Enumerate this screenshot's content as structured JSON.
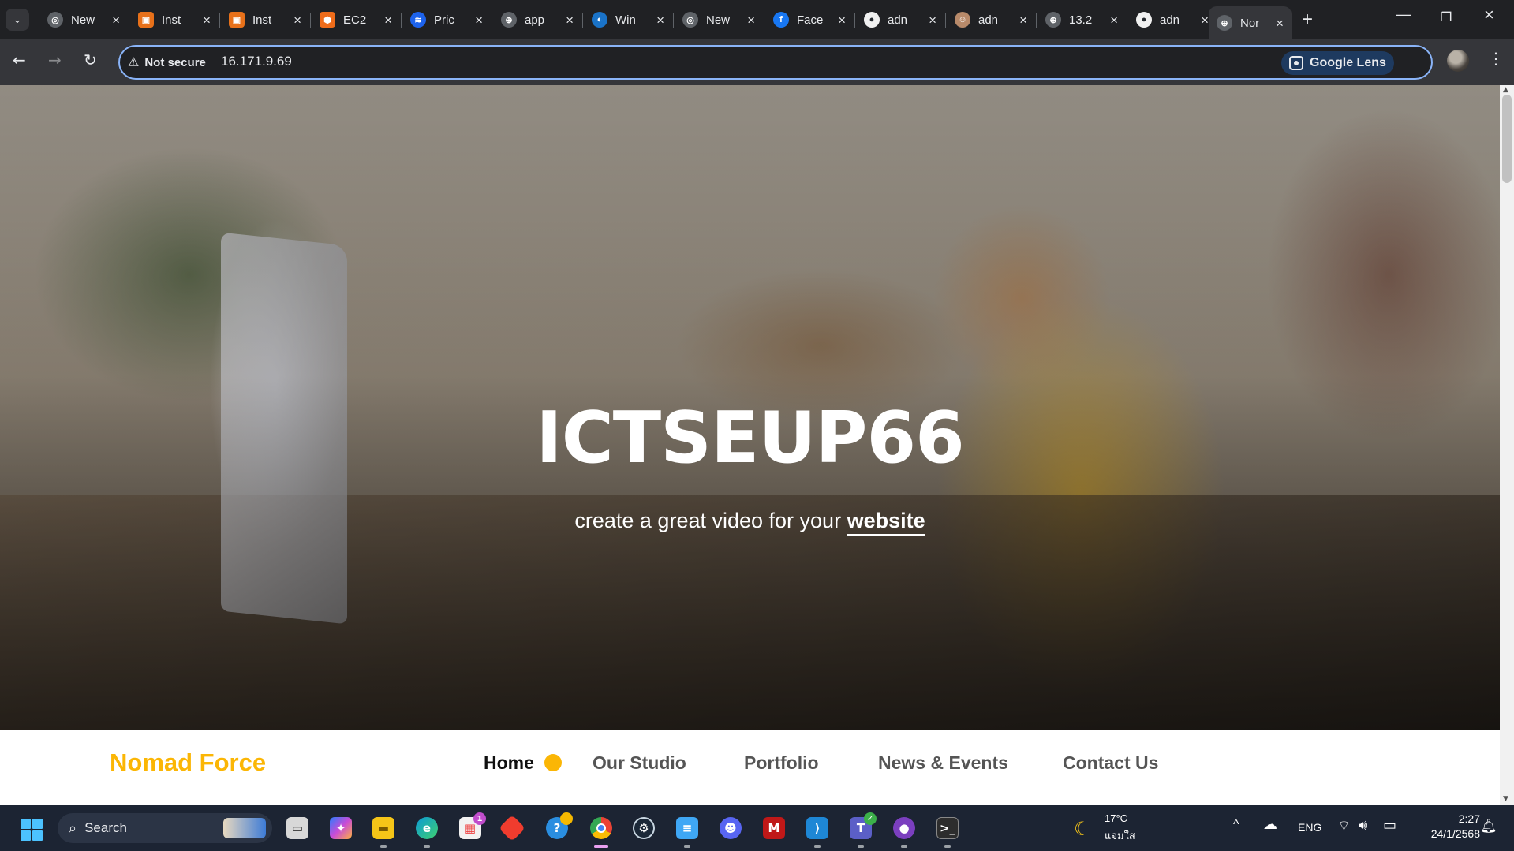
{
  "browser": {
    "tabs": [
      {
        "title": "New",
        "icon": "chrome-icon",
        "color": "#5f6368"
      },
      {
        "title": "Inst",
        "icon": "aws-instance-icon",
        "color": "#e8711a"
      },
      {
        "title": "Inst",
        "icon": "aws-instance-icon",
        "color": "#e8711a"
      },
      {
        "title": "EC2",
        "icon": "ec2-icon",
        "color": "#ef6c1a"
      },
      {
        "title": "Pric",
        "icon": "docker-icon",
        "color": "#1d63ed"
      },
      {
        "title": "app",
        "icon": "globe-icon",
        "color": "#5f6368"
      },
      {
        "title": "Win",
        "icon": "edge-icon",
        "color": "#1a73c8"
      },
      {
        "title": "New",
        "icon": "chrome-icon",
        "color": "#5f6368"
      },
      {
        "title": "Face",
        "icon": "facebook-icon",
        "color": "#1877f2"
      },
      {
        "title": "adn",
        "icon": "github-icon",
        "color": "#24292e"
      },
      {
        "title": "adn",
        "icon": "avatar-icon",
        "color": "#b88a6a"
      },
      {
        "title": "13.2",
        "icon": "globe-icon",
        "color": "#5f6368"
      },
      {
        "title": "adn",
        "icon": "github-icon",
        "color": "#24292e"
      },
      {
        "title": "Nor",
        "icon": "globe-icon",
        "color": "#5f6368"
      }
    ],
    "active_tab_index": 13,
    "security_label": "Not secure",
    "url": "16.171.9.69",
    "lens_label": "Google Lens"
  },
  "page": {
    "hero_title": "ICTSEUP66",
    "hero_sub_prefix": "create a great video for your ",
    "hero_sub_emphasis": "website",
    "brand": "Nomad Force",
    "brand_color": "#fbb605",
    "menu": [
      {
        "label": "Home",
        "active": true
      },
      {
        "label": "Our Studio",
        "active": false
      },
      {
        "label": "Portfolio",
        "active": false
      },
      {
        "label": "News & Events",
        "active": false
      },
      {
        "label": "Contact Us",
        "active": false
      }
    ]
  },
  "taskbar": {
    "search_placeholder": "Search",
    "apps": [
      "file-explorer-window-icon",
      "copilot-icon",
      "folder-icon",
      "edge-icon",
      "microsoft-store-icon",
      "git-icon",
      "help-icon",
      "chrome-icon",
      "steam-icon",
      "notepad-icon",
      "discord-icon",
      "mcafee-icon",
      "vscode-icon",
      "teams-icon",
      "github-desktop-icon",
      "terminal-icon"
    ],
    "store_badge": "1",
    "weather_temp": "17°C",
    "weather_desc": "แจ่มใส",
    "language": "ENG",
    "time": "2:27",
    "date": "24/1/2568"
  }
}
